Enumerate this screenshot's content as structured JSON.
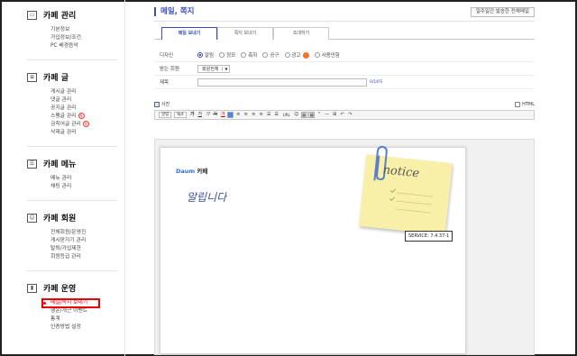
{
  "sidebar": {
    "sections": [
      {
        "icon": "browser-window-icon",
        "title": "카페 관리",
        "items": [
          "기본정보",
          "가입정보/조건",
          "PC 배경음악"
        ]
      },
      {
        "icon": "document-list-icon",
        "title": "카페 글",
        "items": [
          "게시글 관리",
          "댓글 관리",
          "공지글 관리",
          "스팸글 관리",
          "금칙어글 관리",
          "삭제글 관리"
        ]
      },
      {
        "icon": "menu-list-icon",
        "title": "카페 메뉴",
        "items": [
          "메뉴 관리",
          "채팅 관리"
        ]
      },
      {
        "icon": "member-card-icon",
        "title": "카페 회원",
        "items": [
          "전체회원/운영진",
          "게시판지기 관리",
          "탈퇴/가입제한",
          "회원등급 관리"
        ]
      },
      {
        "icon": "bar-chart-icon",
        "title": "카페 운영",
        "items": [
          "메일/쪽지 보내기",
          "행운/개근 이벤트",
          "통계",
          "인증방법 설정"
        ]
      }
    ],
    "new_badge": "N"
  },
  "main": {
    "title": "메일, 쪽지",
    "top_button": "일주일간 발송한 전체메일",
    "tabs": [
      "메일 보내기",
      "쪽지 보내기",
      "초대하기"
    ],
    "form": {
      "design_label": "디자인",
      "design_options": [
        "알림",
        "정모",
        "축하",
        "공구",
        "광고",
        "사용안함"
      ],
      "recipient_label": "받는 회원",
      "recipient_value": "회원전체",
      "subject_label": "제목",
      "subject_value": "",
      "subject_count": "0/16자"
    },
    "editor": {
      "photo_label": "사진",
      "html_label": "HTML",
      "font_value": "굴림",
      "size_value": "9pt",
      "toolbar": [
        "가",
        "가",
        "가",
        "가",
        "가",
        "≡",
        "≡",
        "≡",
        "≡",
        "☰",
        "☰",
        "URL",
        "☺",
        "▦",
        "▦",
        "\"",
        "—",
        "⊞",
        "↶",
        "↷"
      ],
      "logo_brand": "Daum",
      "logo_text": "카페",
      "handwriting": "알립니다",
      "note_text": "notice",
      "service_tooltip": "SERVICE: 7.4.37-1"
    }
  },
  "colors": {
    "accent": "#3a4dbf",
    "highlight": "#e00000",
    "note": "#f8f0a8"
  }
}
